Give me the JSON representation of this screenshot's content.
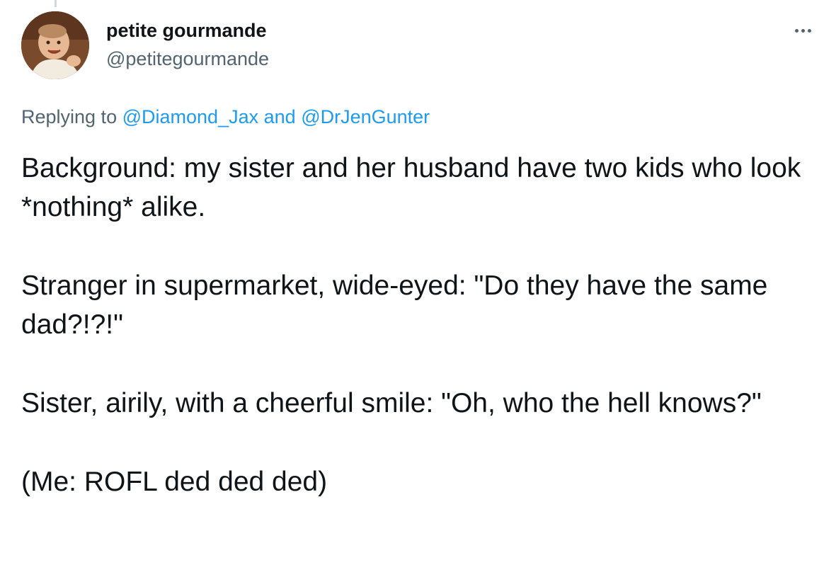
{
  "tweet": {
    "author": {
      "display_name": "petite gourmande",
      "handle": "@petitegourmande",
      "avatar_icon": "profile-photo-baby"
    },
    "more_icon": "ellipsis-icon",
    "replying": {
      "prefix": "Replying to",
      "mention_1": "@Diamond_Jax",
      "joiner": "and",
      "mention_2": "@DrJenGunter"
    },
    "body": {
      "paragraph_1": "Background: my sister and her husband have two kids who look *nothing* alike.",
      "paragraph_2": "Stranger in supermarket, wide-eyed: \"Do they have the same dad?!?!\"",
      "paragraph_3": "Sister, airily, with a cheerful smile: \"Oh, who the hell knows?\"",
      "paragraph_4": "(Me: ROFL ded ded ded)"
    },
    "colors": {
      "text": "#0f1419",
      "secondary": "#536471",
      "link": "#1d9bf0"
    }
  }
}
